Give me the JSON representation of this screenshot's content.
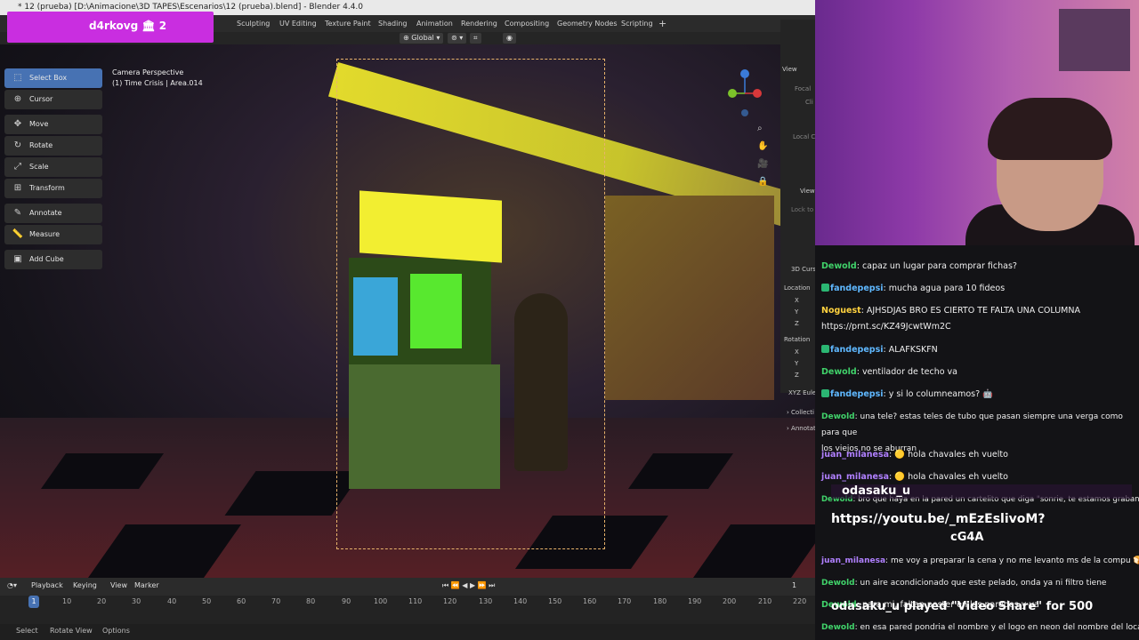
{
  "window": {
    "title": "* 12 (prueba) [D:\\Animacione\\3D TAPES\\Escenarios\\12 (prueba).blend] - Blender 4.4.0"
  },
  "workspaces": [
    "Sculpting",
    "UV Editing",
    "Texture Paint",
    "Shading",
    "Animation",
    "Rendering",
    "Compositing",
    "Geometry Nodes",
    "Scripting",
    "+"
  ],
  "header": {
    "orientation": "Global"
  },
  "viewport": {
    "camera_label": "Camera Perspective",
    "object_label": "(1) Time Crisis | Area.014"
  },
  "toolbar": {
    "tools": [
      "Select Box",
      "Cursor",
      "Move",
      "Rotate",
      "Scale",
      "Transform",
      "Annotate",
      "Measure",
      "Add Cube"
    ],
    "icons": [
      "select-box-icon",
      "cursor-icon",
      "move-icon",
      "rotate-icon",
      "scale-icon",
      "transform-icon",
      "annotate-icon",
      "measure-icon",
      "add-cube-icon"
    ]
  },
  "npanel": {
    "view_title": "View",
    "focal": "Focal",
    "clip": "Cli",
    "local_camera": "Local C",
    "view2": "View",
    "lock": "Lock to",
    "cursor_title": "3D Curs",
    "location": "Location",
    "x": "X",
    "y": "Y",
    "z": "Z",
    "rotation": "Rotation",
    "rx": "X",
    "ry": "Y",
    "rz": "Z",
    "xyz": "XYZ Eule",
    "collections": "Collecti",
    "annotations": "Annotat"
  },
  "timeline": {
    "menus": [
      "Playback",
      "Keying",
      "View",
      "Marker"
    ],
    "current_frame": "1",
    "frame_indicator": "1",
    "ticks": [
      "10",
      "20",
      "30",
      "40",
      "50",
      "60",
      "70",
      "80",
      "90",
      "100",
      "110",
      "120",
      "130",
      "140",
      "150",
      "160",
      "170",
      "180",
      "190",
      "200",
      "210",
      "220"
    ]
  },
  "statusbar": {
    "items": [
      "Select",
      "Rotate View",
      "Options"
    ]
  },
  "stream_badge": {
    "text": "d4rkovg 🏛 2"
  },
  "chat": [
    {
      "user": "Dewold",
      "text": "capaz un lugar para comprar fichas?",
      "color": "#40d26a"
    },
    {
      "user": "fandepepsi",
      "text": "mucha agua para 10 fideos",
      "color": "#5fb8ff",
      "badge": true
    },
    {
      "user": "Noguest",
      "text": "AJHSDJAS BRO ES CIERTO TE FALTA UNA COLUMNA",
      "color": "#ffd23f",
      "line2": "https://prnt.sc/KZ49JcwtWm2C"
    },
    {
      "user": "fandepepsi",
      "text": "ALAFKSKFN",
      "color": "#5fb8ff",
      "badge": true
    },
    {
      "user": "Dewold",
      "text": "ventilador de techo va",
      "color": "#40d26a"
    },
    {
      "user": "fandepepsi",
      "text": "y si lo columneamos? 🤖",
      "color": "#5fb8ff",
      "badge": true
    },
    {
      "user": "Dewold",
      "text": "una tele? estas teles de tubo que pasan siempre una verga como para que",
      "color": "#40d26a",
      "line2": "los viejos no se aburran"
    },
    {
      "user": "juan_milanesa",
      "text": "🟡 hola chavales eh vuelto",
      "color": "#b080ff"
    },
    {
      "user": "juan_milanesa",
      "text": "🟡 hola chavales eh vuelto",
      "color": "#b080ff"
    },
    {
      "user": "Dewold",
      "text": "bro que haya en la pared un cartelito que diga \"sonrie, te estamos grabando\"",
      "color": "#40d26a"
    },
    {
      "user": "juan_milanesa",
      "text": "me voy a preparar la cena y no me levanto ms de la compu 🍞",
      "color": "#b080ff"
    },
    {
      "user": "Dewold",
      "text": "un aire acondicionado que este pelado, onda ya ni filtro tiene",
      "color": "#40d26a"
    },
    {
      "user": "Dewold",
      "text": "para mi, faltan poster en las paredes y ya",
      "color": "#40d26a"
    },
    {
      "user": "Dewold",
      "text": "en esa pared pondria el nombre y el logo en neon del nombre del local",
      "color": "#40d26a"
    }
  ],
  "alerts": {
    "name1": "odasaku_u",
    "link": "https://youtu.be/_mEzEslivoM?",
    "code": "cG4A",
    "played": "odasaku_u played \"Video Share\" for 500"
  },
  "colors": {
    "accent": "#4772b3",
    "badge": "#c92ee0"
  }
}
